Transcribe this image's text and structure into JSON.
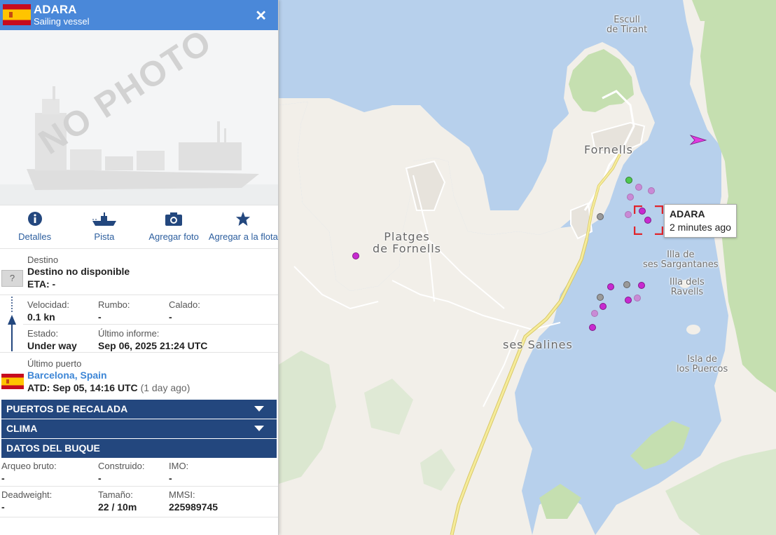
{
  "vessel": {
    "name": "ADARA",
    "type": "Sailing vessel",
    "flag": "Spain",
    "photo_watermark": "NO PHOTO"
  },
  "actions": [
    {
      "label": "Detalles",
      "icon": "info-icon"
    },
    {
      "label": "Pista",
      "icon": "ship-track-icon"
    },
    {
      "label": "Agregar foto",
      "icon": "camera-icon"
    },
    {
      "label": "Agregar a la flota",
      "icon": "star-icon"
    }
  ],
  "destination": {
    "label": "Destino",
    "value": "Destino no disponible",
    "eta": "ETA: -",
    "unknown_symbol": "?"
  },
  "nav": {
    "speed_label": "Velocidad:",
    "speed": "0.1 kn",
    "course_label": "Rumbo:",
    "course": "-",
    "draught_label": "Calado:",
    "draught": "-",
    "status_label": "Estado:",
    "status": "Under way",
    "last_report_label": "Último informe:",
    "last_report": "Sep 06, 2025 21:24 UTC"
  },
  "last_port": {
    "label": "Último puerto",
    "name": "Barcelona, Spain",
    "atd": "ATD: Sep 05, 14:16 UTC",
    "ago": "(1 day ago)"
  },
  "sections": {
    "ports": "PUERTOS DE RECALADA",
    "weather": "CLIMA",
    "ship_data": "DATOS DEL BUQUE"
  },
  "ship_data": {
    "gross_tonnage_label": "Arqueo bruto:",
    "gross_tonnage": "-",
    "built_label": "Construido:",
    "built": "-",
    "imo_label": "IMO:",
    "imo": "-",
    "deadweight_label": "Deadweight:",
    "deadweight": "-",
    "size_label": "Tamaño:",
    "size": "22 / 10m",
    "mmsi_label": "MMSI:",
    "mmsi": "225989745"
  },
  "map": {
    "places": {
      "escull1": "Escull",
      "escull2": "de Tirant",
      "fornells": "Fornells",
      "platges1": "Platges",
      "platges2": "de Fornells",
      "sargantanes1": "Illa de",
      "sargantanes2": "ses Sargantanes",
      "ravells1": "Illa dels",
      "ravells2": "Ravells",
      "salines": "ses Salines",
      "puercos1": "Isla de",
      "puercos2": "los Puercos"
    },
    "tooltip": {
      "name": "ADARA",
      "time": "2 minutes ago"
    }
  },
  "colors": {
    "header": "#4a88d9",
    "section_bar": "#23477e",
    "water": "#b7d0ec",
    "land": "#f2efe9",
    "forest": "#c5dfb0",
    "selection": "#e0252c"
  }
}
